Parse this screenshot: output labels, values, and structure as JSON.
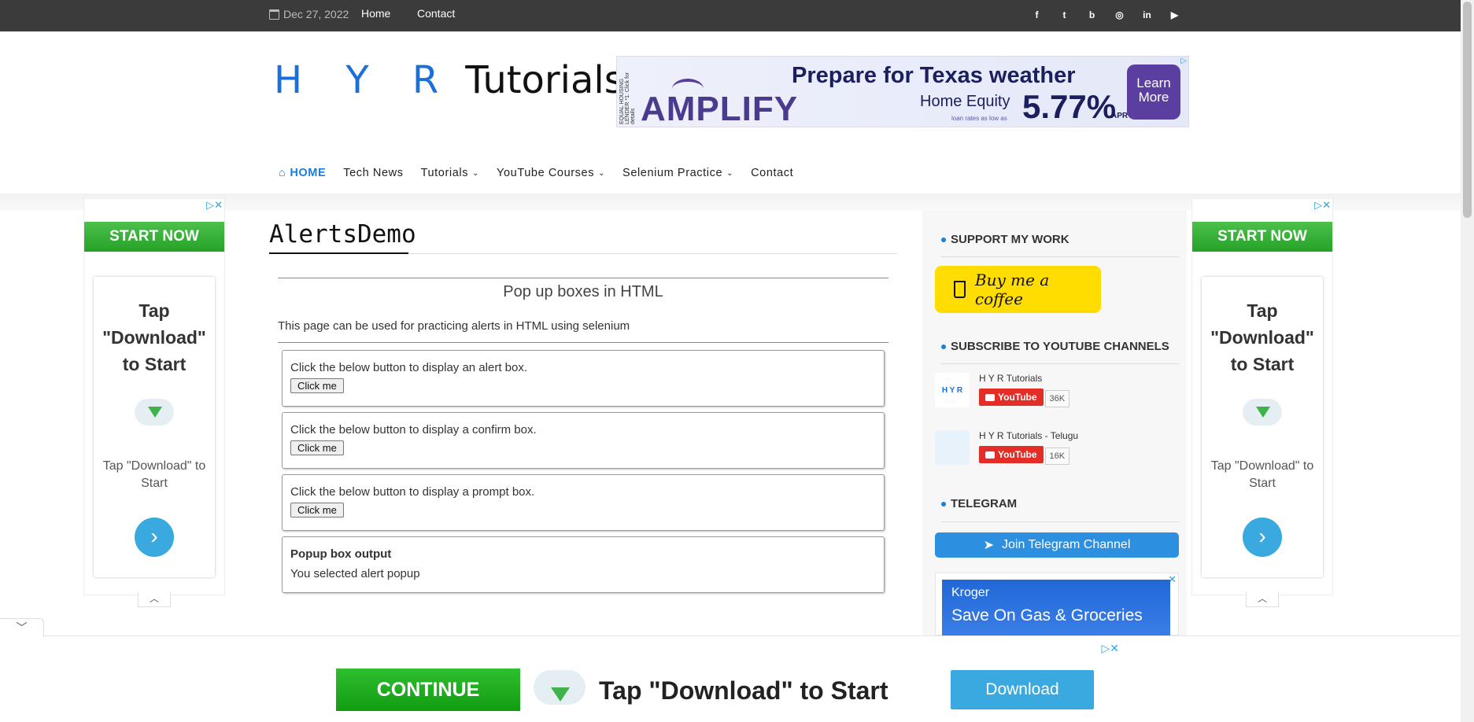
{
  "topbar": {
    "date": "Dec 27, 2022",
    "links": [
      "Home",
      "Contact"
    ],
    "social_icons": [
      "facebook-icon",
      "twitter-icon",
      "blogger-icon",
      "instagram-icon",
      "linkedin-icon",
      "youtube-icon"
    ],
    "social_glyphs": [
      "f",
      "t",
      "b",
      "◎",
      "in",
      "▶"
    ]
  },
  "logo": {
    "blue": "H Y R",
    "black": "Tutorials"
  },
  "header_ad": {
    "side_text": "EQUAL HOUSING LENDER *1. Click for details",
    "brand": "AMPLIFY",
    "headline": "Prepare for Texas weather",
    "home_equity": "Home Equity",
    "small": "loan rates as low as",
    "rate": "5.77%",
    "apr": "APR¹",
    "learn_more": "Learn More"
  },
  "nav": {
    "items": [
      "HOME",
      "Tech News",
      "Tutorials",
      "YouTube Courses",
      "Selenium Practice",
      "Contact"
    ]
  },
  "side_ad": {
    "start": "START NOW",
    "tap": "Tap \"Download\" to Start",
    "tap2": "Tap \"Download\" to Start"
  },
  "main": {
    "title": "AlertsDemo",
    "subhead": "Pop up boxes in HTML",
    "intro": "This page can be used for practicing alerts in HTML using selenium",
    "boxes": [
      {
        "text": "Click the below button to display an alert box.",
        "button": "Click me"
      },
      {
        "text": "Click the below button to display a confirm box.",
        "button": "Click me"
      },
      {
        "text": "Click the below button to display a prompt box.",
        "button": "Click me"
      }
    ],
    "output": {
      "label": "Popup box output",
      "value": "You selected alert popup"
    }
  },
  "sidebar": {
    "support_heading": "SUPPORT MY WORK",
    "coffee": "Buy me a coffee",
    "subscribe_heading": "SUBSCRIBE TO YOUTUBE CHANNELS",
    "channels": [
      {
        "name": "H Y R Tutorials",
        "button": "YouTube",
        "count": "36K",
        "avatar": "H Y R"
      },
      {
        "name": "H Y R Tutorials - Telugu",
        "button": "YouTube",
        "count": "16K",
        "avatar": ""
      }
    ],
    "telegram_heading": "TELEGRAM",
    "telegram_button": "Join Telegram Channel",
    "kroger_brand": "Kroger",
    "kroger_headline": "Save On Gas & Groceries"
  },
  "bottom_ad": {
    "continue": "CONTINUE",
    "tap": "Tap \"Download\" to Start",
    "download": "Download"
  },
  "colors": {
    "accent": "#1a7de0",
    "topbar": "#3b3b3b",
    "start_green": "#27a227",
    "coffee_yellow": "#ffdd00",
    "youtube_red": "#e52d27",
    "telegram_blue": "#2d8fe0"
  }
}
